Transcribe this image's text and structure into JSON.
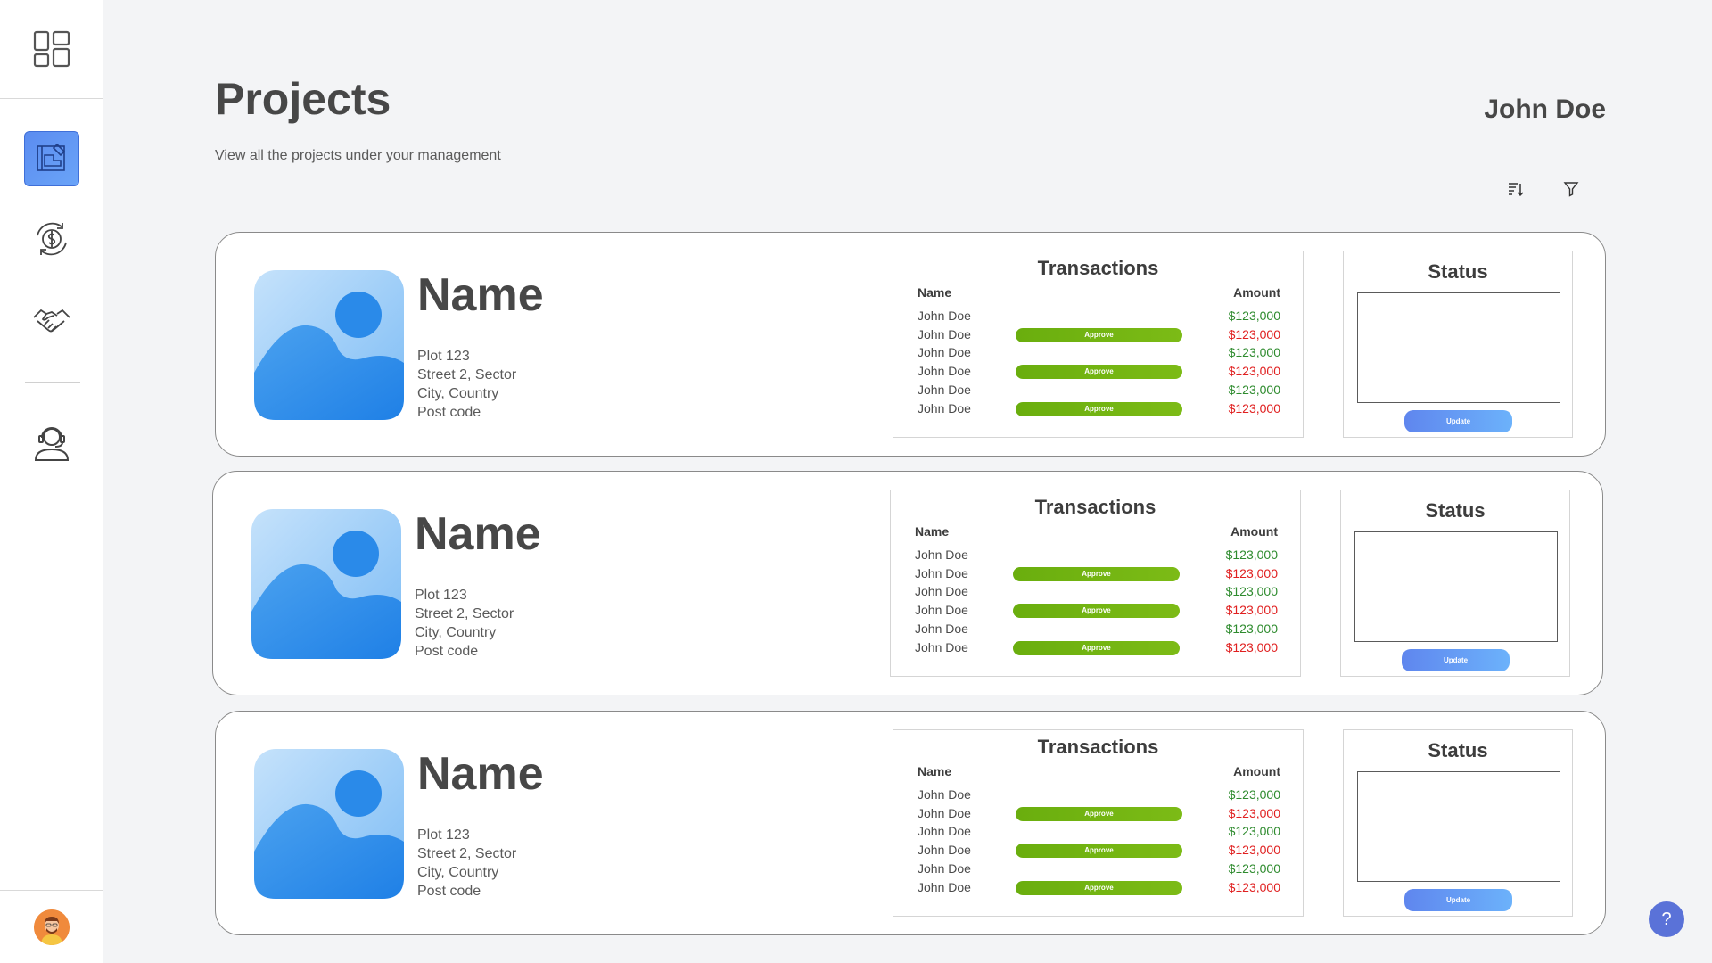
{
  "header": {
    "title": "Projects",
    "subtitle": "View all the projects under your management",
    "user_name": "John Doe"
  },
  "toolbar": {
    "sort_icon": "sort-descending-icon",
    "filter_icon": "filter-icon"
  },
  "sidebar": {
    "logo_icon": "dashboard-grid-icon",
    "items": [
      {
        "name": "projects",
        "icon": "blueprint-icon",
        "active": true
      },
      {
        "name": "finance",
        "icon": "dollar-exchange-icon",
        "active": false
      },
      {
        "name": "deals",
        "icon": "handshake-icon",
        "active": false
      },
      {
        "name": "support",
        "icon": "support-agent-icon",
        "active": false
      }
    ],
    "avatar_icon": "user-avatar"
  },
  "projects": [
    {
      "name": "Name",
      "address": [
        "Plot 123",
        "Street 2, Sector",
        "City, Country",
        "Post code"
      ],
      "transactions_title": "Transactions",
      "col_name": "Name",
      "col_amount": "Amount",
      "rows": [
        {
          "name": "John Doe",
          "amount": "$123,000",
          "type": "pos",
          "approve": ""
        },
        {
          "name": "John Doe",
          "amount": "$123,000",
          "type": "neg",
          "approve": "Approve"
        },
        {
          "name": "John Doe",
          "amount": "$123,000",
          "type": "pos",
          "approve": ""
        },
        {
          "name": "John Doe",
          "amount": "$123,000",
          "type": "neg",
          "approve": "Approve"
        },
        {
          "name": "John Doe",
          "amount": "$123,000",
          "type": "pos",
          "approve": ""
        },
        {
          "name": "John Doe",
          "amount": "$123,000",
          "type": "neg",
          "approve": "Approve"
        }
      ],
      "status_title": "Status",
      "update_label": "Update"
    },
    {
      "name": "Name",
      "address": [
        "Plot 123",
        "Street 2, Sector",
        "City, Country",
        "Post code"
      ],
      "transactions_title": "Transactions",
      "col_name": "Name",
      "col_amount": "Amount",
      "rows": [
        {
          "name": "John Doe",
          "amount": "$123,000",
          "type": "pos",
          "approve": ""
        },
        {
          "name": "John Doe",
          "amount": "$123,000",
          "type": "neg",
          "approve": "Approve"
        },
        {
          "name": "John Doe",
          "amount": "$123,000",
          "type": "pos",
          "approve": ""
        },
        {
          "name": "John Doe",
          "amount": "$123,000",
          "type": "neg",
          "approve": "Approve"
        },
        {
          "name": "John Doe",
          "amount": "$123,000",
          "type": "pos",
          "approve": ""
        },
        {
          "name": "John Doe",
          "amount": "$123,000",
          "type": "neg",
          "approve": "Approve"
        }
      ],
      "status_title": "Status",
      "update_label": "Update"
    },
    {
      "name": "Name",
      "address": [
        "Plot 123",
        "Street 2, Sector",
        "City, Country",
        "Post code"
      ],
      "transactions_title": "Transactions",
      "col_name": "Name",
      "col_amount": "Amount",
      "rows": [
        {
          "name": "John Doe",
          "amount": "$123,000",
          "type": "pos",
          "approve": ""
        },
        {
          "name": "John Doe",
          "amount": "$123,000",
          "type": "neg",
          "approve": "Approve"
        },
        {
          "name": "John Doe",
          "amount": "$123,000",
          "type": "pos",
          "approve": ""
        },
        {
          "name": "John Doe",
          "amount": "$123,000",
          "type": "neg",
          "approve": "Approve"
        },
        {
          "name": "John Doe",
          "amount": "$123,000",
          "type": "pos",
          "approve": ""
        },
        {
          "name": "John Doe",
          "amount": "$123,000",
          "type": "neg",
          "approve": "Approve"
        }
      ],
      "status_title": "Status",
      "update_label": "Update"
    }
  ],
  "help_label": "?",
  "colors": {
    "accent": "#5b8cf0",
    "approve": "#6aae0e",
    "amount_positive": "#2e8b2e",
    "amount_negative": "#e02020",
    "help": "#5a72d8"
  }
}
